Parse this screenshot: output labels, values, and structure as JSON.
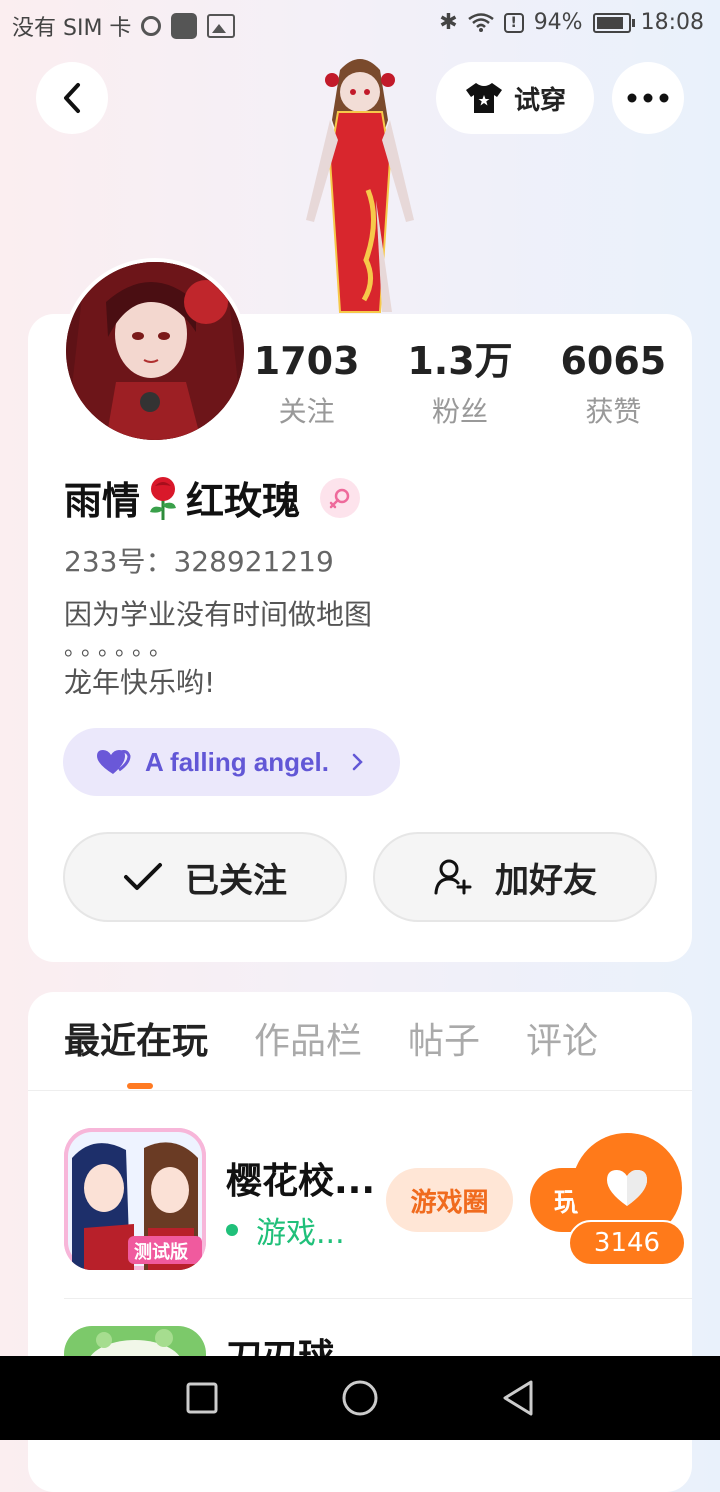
{
  "status_bar": {
    "carrier": "没有 SIM 卡",
    "battery": "94%",
    "time": "18:08"
  },
  "header": {
    "try_on_label": "试穿"
  },
  "profile": {
    "stats": [
      {
        "value": "1703",
        "label": "关注"
      },
      {
        "value": "1.3万",
        "label": "粉丝"
      },
      {
        "value": "6065",
        "label": "获赞"
      }
    ],
    "name_part1": "雨情",
    "name_part2": "红玫瑰",
    "uid": "233号：328921219",
    "bio_line1": "因为学业没有时间做地图",
    "bio_line2": "。。。。。。",
    "bio_line3": "龙年快乐哟!",
    "tag_label": "A falling angel.",
    "follow_label": "已关注",
    "add_friend_label": "加好友"
  },
  "tabs": [
    "最近在玩",
    "作品栏",
    "帖子",
    "评论"
  ],
  "games": [
    {
      "title": "樱花校...",
      "status": "游戏...",
      "circle_btn": "游戏圈",
      "play_btn": "玩",
      "icon_badge": "测试版"
    },
    {
      "title": "刀刃球"
    }
  ],
  "like": {
    "count": "3146"
  },
  "colors": {
    "accent": "#ff7a1a",
    "tag_purple": "#6257d6",
    "online_green": "#20c07a"
  }
}
